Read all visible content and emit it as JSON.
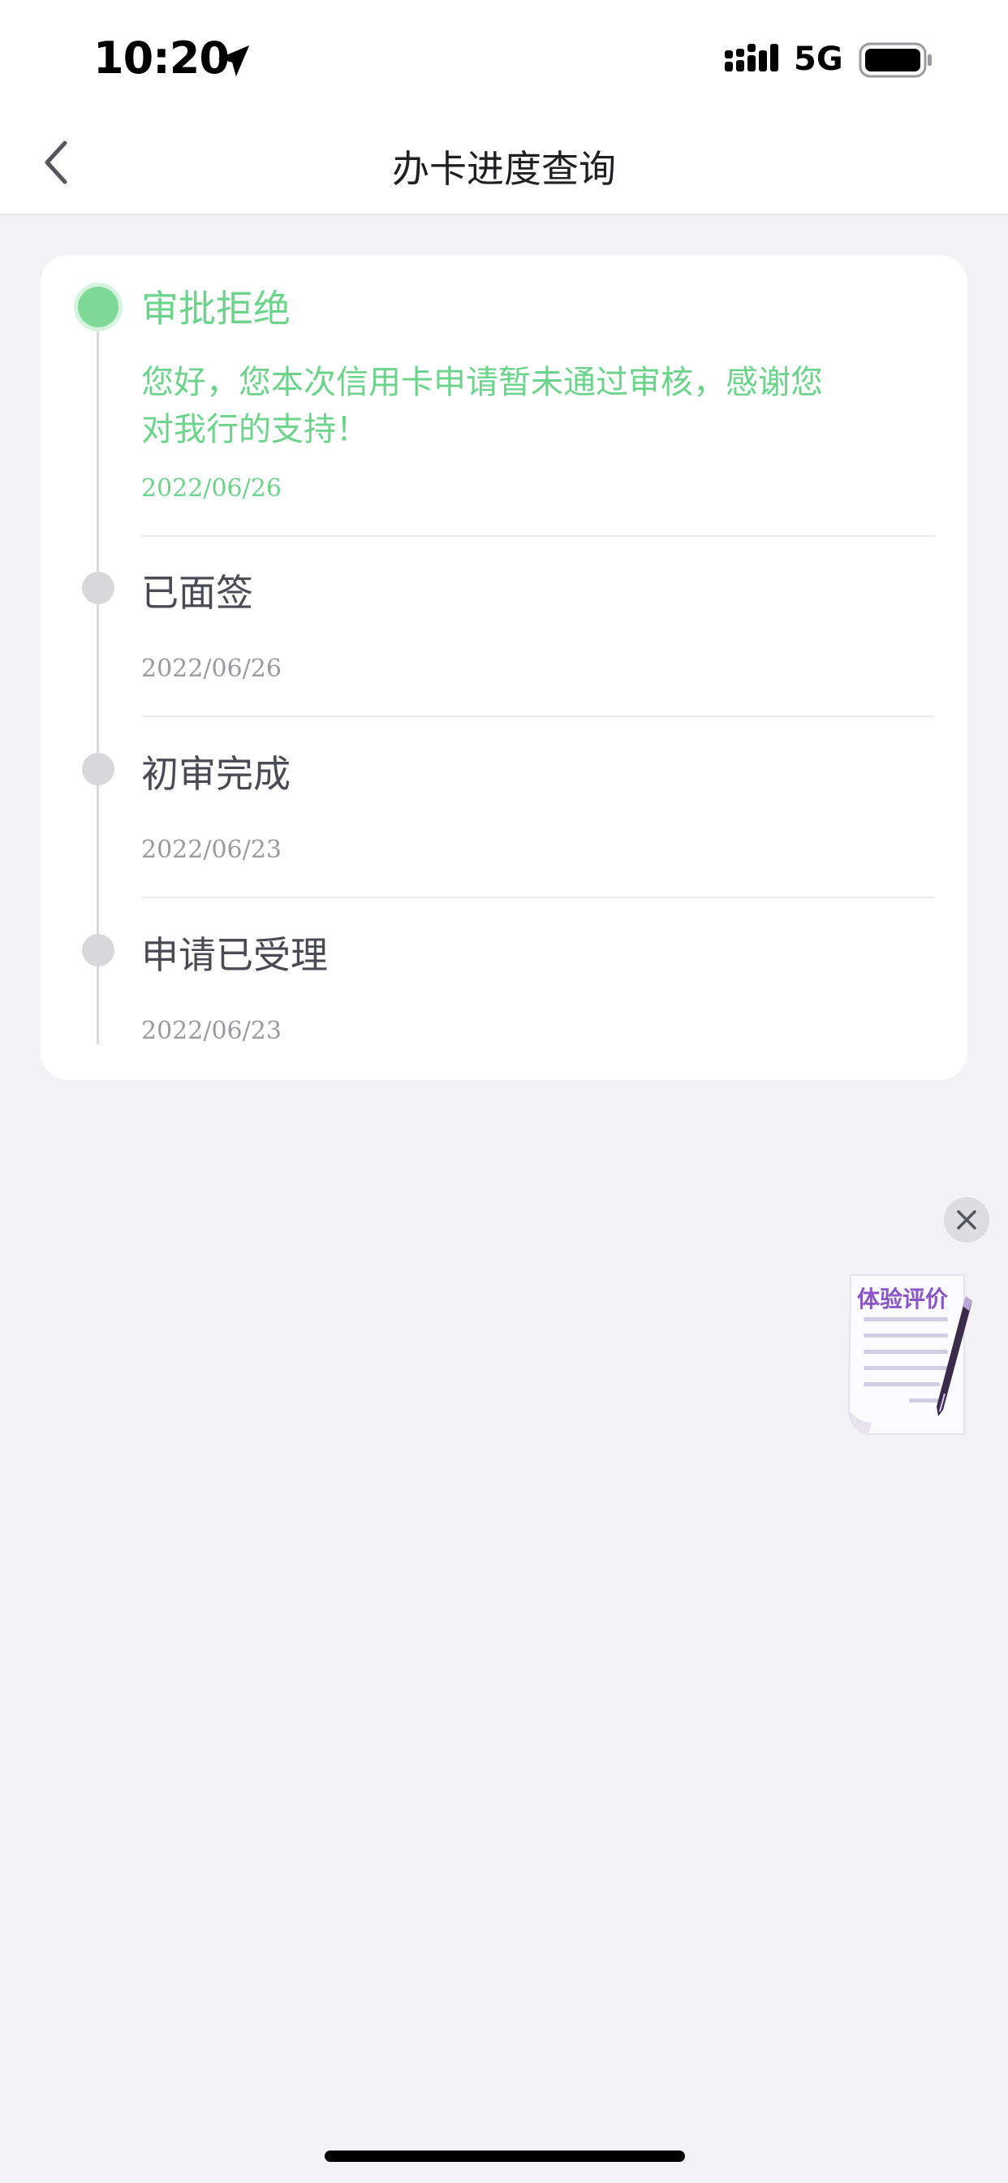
{
  "status_bar": {
    "time": "10:20",
    "network": "5G",
    "icons": [
      "location-arrow-icon",
      "signal-icon",
      "battery-icon"
    ]
  },
  "nav": {
    "title": "办卡进度查询",
    "back_icon": "chevron-left-icon"
  },
  "timeline": {
    "steps": [
      {
        "title": "审批拒绝",
        "desc_line1": "您好，您本次信用卡申请暂未通过审核，感谢您",
        "desc_line2": "对我行的支持！",
        "date": "2022/06/26",
        "status": "active"
      },
      {
        "title": "已面签",
        "date": "2022/06/26",
        "status": "done"
      },
      {
        "title": "初审完成",
        "date": "2022/06/23",
        "status": "done"
      },
      {
        "title": "申请已受理",
        "date": "2022/06/23",
        "status": "done"
      }
    ]
  },
  "floating": {
    "feedback_label": "体验评价",
    "close_icon": "close-icon"
  },
  "colors": {
    "active_green": "#6cd38b",
    "background": "#f3f3f5",
    "card": "#ffffff",
    "feedback_purple": "#8a55c8"
  }
}
